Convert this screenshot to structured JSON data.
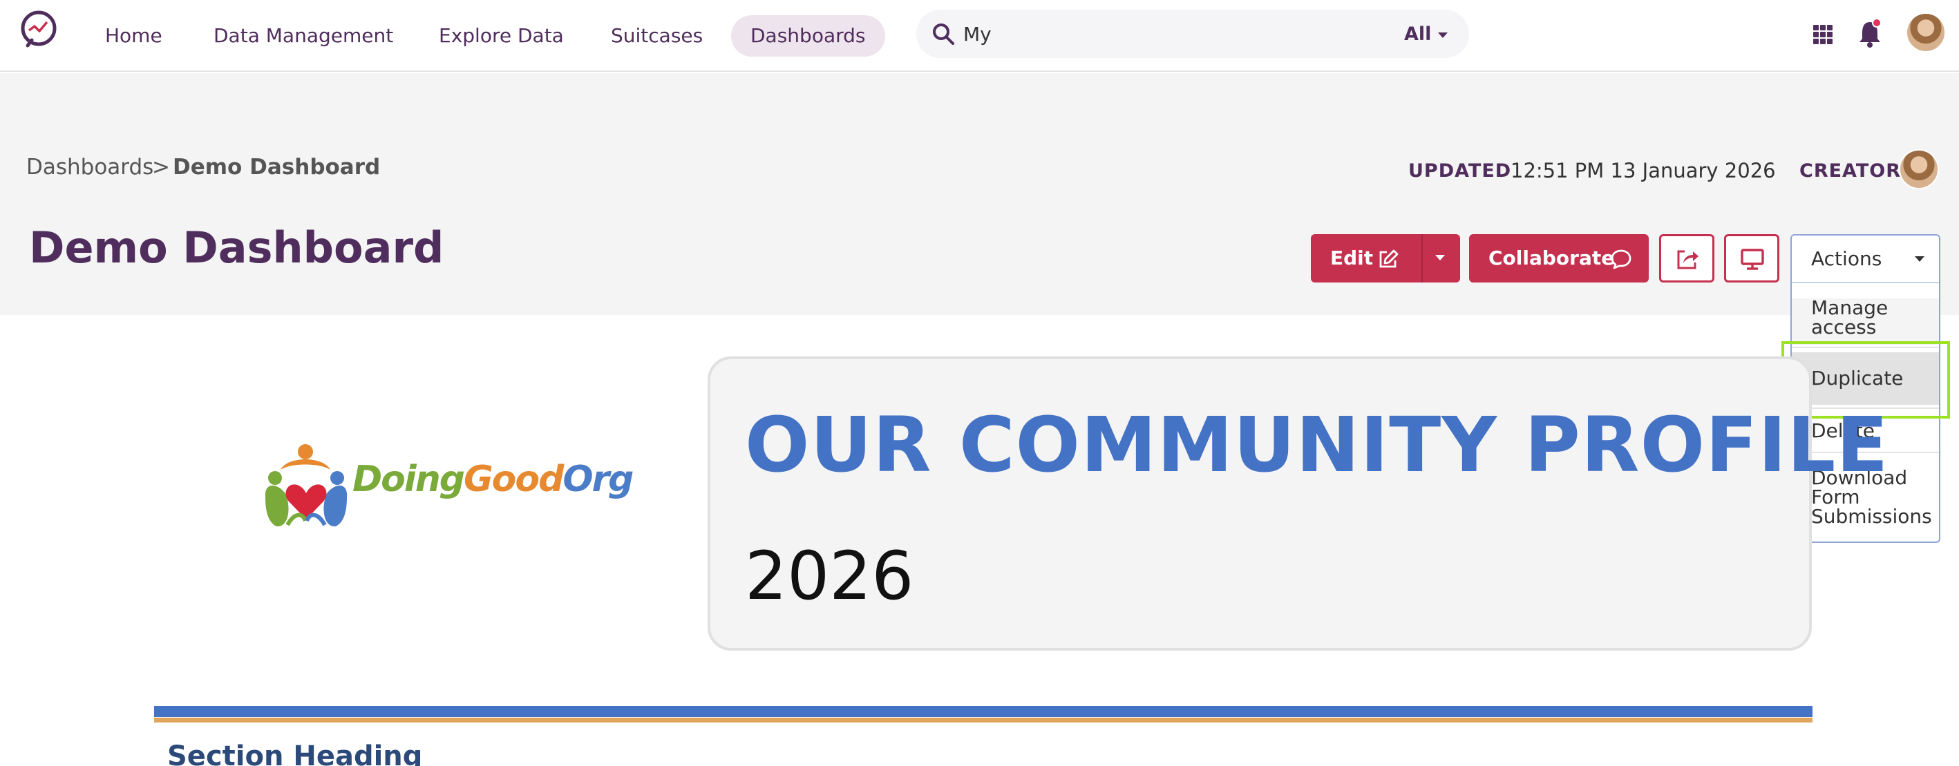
{
  "nav": {
    "items": [
      {
        "label": "Home",
        "active": false
      },
      {
        "label": "Data Management",
        "active": false
      },
      {
        "label": "Explore Data",
        "active": false
      },
      {
        "label": "Suitcases",
        "active": false
      },
      {
        "label": "Dashboards",
        "active": true
      }
    ]
  },
  "search": {
    "value": "My",
    "scope": "All"
  },
  "icons": {
    "apps": "grid-icon",
    "notifications": "bell-icon"
  },
  "breadcrumb": {
    "parent": "Dashboards",
    "separator": ">",
    "current": "Demo Dashboard"
  },
  "meta": {
    "updated_label": "UPDATED",
    "updated_value": "12:51 PM 13 January 2026",
    "creator_label": "CREATOR"
  },
  "page": {
    "title": "Demo Dashboard"
  },
  "toolbar": {
    "edit_label": "Edit",
    "collaborate_label": "Collaborate",
    "actions_label": "Actions"
  },
  "actions_menu": {
    "items": [
      "Manage access",
      "Duplicate",
      "Delete",
      "Download Form Submissions"
    ],
    "highlighted": "Duplicate"
  },
  "content": {
    "org_name_parts": [
      "Doing",
      "Good",
      "Org"
    ],
    "profile_title": "OUR COMMUNITY PROFILE",
    "profile_year": "2026",
    "section_heading": "Section Heading"
  },
  "colors": {
    "brand_purple": "#4f2d5c",
    "accent_red": "#c5304e",
    "profile_blue": "#4472c4",
    "band_orange": "#e0a45a",
    "highlight_green": "#9ae223"
  }
}
